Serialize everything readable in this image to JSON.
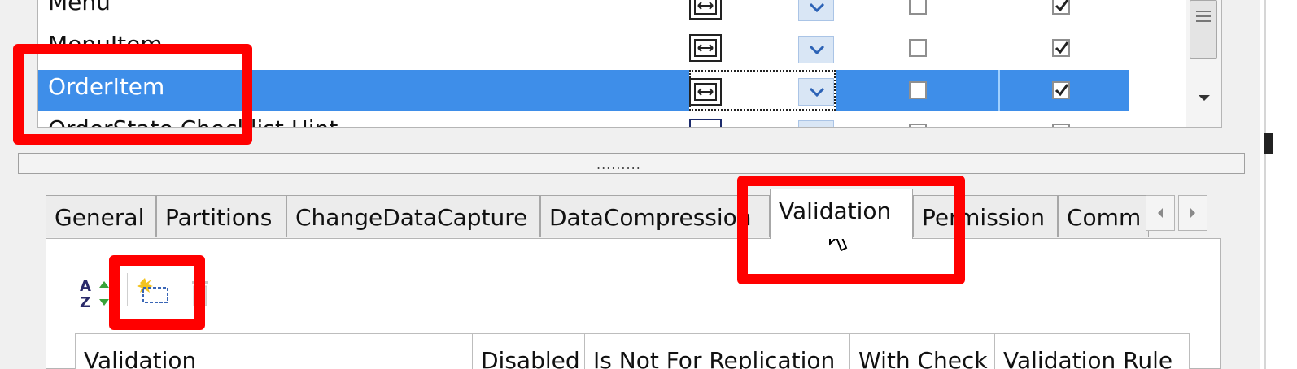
{
  "grid": {
    "rows": [
      {
        "name": "Menu",
        "check1": false,
        "check2": true,
        "selected": false
      },
      {
        "name": "MenuItem",
        "check1": false,
        "check2": true,
        "selected": false
      },
      {
        "name": "OrderItem",
        "check1": false,
        "check2": true,
        "selected": true
      },
      {
        "name": "OrderState Checklist Hint",
        "check1": false,
        "check2": true,
        "selected": false
      }
    ]
  },
  "splitter": {
    "grip": "........."
  },
  "tabs": {
    "items": [
      {
        "label": "General"
      },
      {
        "label": "Partitions"
      },
      {
        "label": "ChangeDataCapture"
      },
      {
        "label": "DataCompression"
      },
      {
        "label": "Validation",
        "active": true
      },
      {
        "label": "Permission"
      },
      {
        "label": "Comm"
      }
    ],
    "nav_left_icon": "tab-scroll-left-icon",
    "nav_right_icon": "tab-scroll-right-icon"
  },
  "toolbar": {
    "sort_icon": "sort-az-icon",
    "new_icon": "new-item-icon",
    "delete_icon": "delete-icon"
  },
  "validation_table": {
    "columns": [
      "Validation",
      "Disabled",
      "Is Not For Replication",
      "With Check",
      "Validation Rule"
    ]
  },
  "annotation_color": "#ff0000",
  "selection_color": "#3e8ee9"
}
